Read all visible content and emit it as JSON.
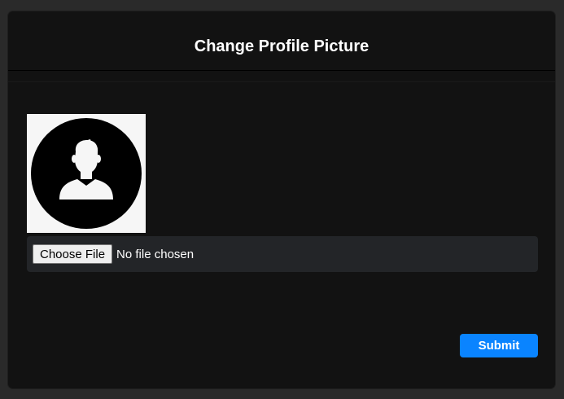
{
  "modal": {
    "title": "Change Profile Picture"
  },
  "avatar": {
    "icon": "user-silhouette-icon"
  },
  "file_input": {
    "button_label": "Choose File",
    "status_text": "No file chosen"
  },
  "actions": {
    "submit_label": "Submit"
  },
  "colors": {
    "background": "#2a2a2a",
    "modal_background": "#121212",
    "file_row_background": "#232528",
    "accent": "#0a84ff",
    "avatar_background": "#f6f6f6"
  }
}
